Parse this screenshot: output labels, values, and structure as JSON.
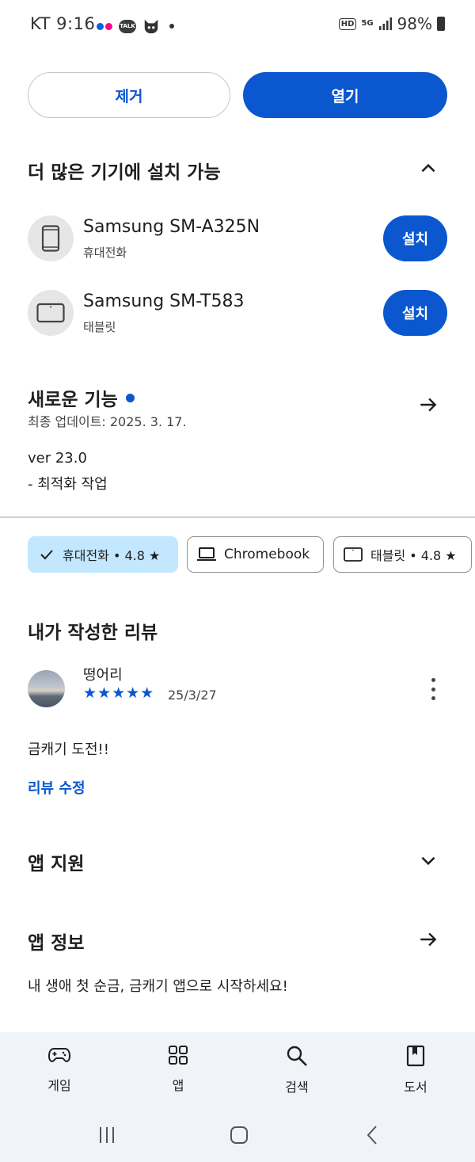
{
  "status_bar": {
    "carrier": "KT",
    "time": "9:16",
    "battery": "98%",
    "talk_label": "TALK",
    "hd_label": "HD",
    "network_label": "5G"
  },
  "actions": {
    "remove_label": "제거",
    "open_label": "열기"
  },
  "more_devices": {
    "title": "더 많은 기기에 설치 가능",
    "devices": [
      {
        "name": "Samsung SM-A325N",
        "type": "휴대전화",
        "install_label": "설치",
        "icon": "phone-icon"
      },
      {
        "name": "Samsung SM-T583",
        "type": "태블릿",
        "install_label": "설치",
        "icon": "tablet-icon"
      }
    ]
  },
  "whats_new": {
    "title": "새로운 기능",
    "updated": "최종 업데이트: 2025. 3. 17.",
    "version": "ver 23.0",
    "notes": "- 최적화 작업"
  },
  "device_chips": [
    {
      "label": "휴대전화 • 4.8 ★",
      "selected": true,
      "icon": "check-icon"
    },
    {
      "label": "Chromebook",
      "selected": false,
      "icon": "laptop-icon"
    },
    {
      "label": "태블릿 • 4.8 ★",
      "selected": false,
      "icon": "tablet-icon"
    }
  ],
  "my_review": {
    "title": "내가 작성한 리뷰",
    "reviewer": "떵어리",
    "rating": 5,
    "stars": "★★★★★",
    "date": "25/3/27",
    "text": "금캐기 도전!!",
    "edit_label": "리뷰 수정"
  },
  "app_support": {
    "title": "앱 지원"
  },
  "app_info": {
    "title": "앱 정보",
    "description": "내 생애 첫 순금, 금캐기 앱으로 시작하세요!"
  },
  "bottom_nav": [
    {
      "label": "게임",
      "icon": "gamepad-icon"
    },
    {
      "label": "앱",
      "icon": "apps-grid-icon"
    },
    {
      "label": "검색",
      "icon": "search-icon"
    },
    {
      "label": "도서",
      "icon": "book-icon"
    }
  ],
  "colors": {
    "accent": "#0b57d0",
    "chip_selected": "#c2e7ff",
    "nav_background": "#f0f4f9"
  }
}
